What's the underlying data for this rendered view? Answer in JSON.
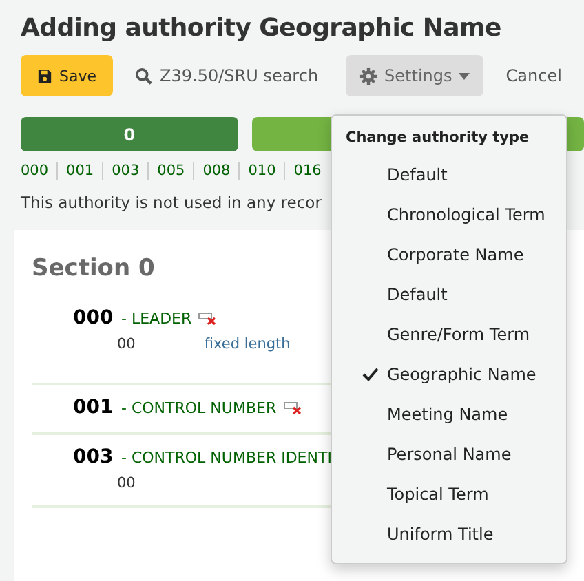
{
  "page_title": "Adding authority Geographic Name",
  "toolbar": {
    "save": "Save",
    "search": "Z39.50/SRU search",
    "settings": "Settings",
    "cancel": "Cancel"
  },
  "progress_tabs": [
    {
      "label": "0",
      "selected": true
    }
  ],
  "tag_links": [
    "000",
    "001",
    "003",
    "005",
    "008",
    "010",
    "016"
  ],
  "message": "This authority is not used in any recor",
  "section_title": "Section 0",
  "fields": [
    {
      "tag": "000",
      "name": "- LEADER",
      "deletable": true,
      "subfield": "00",
      "subfield_label": "fixed length"
    },
    {
      "tag": "001",
      "name": "- CONTROL NUMBER",
      "deletable": true
    },
    {
      "tag": "003",
      "name": "- CONTROL NUMBER IDENTI",
      "deletable": false,
      "subfield": "00"
    }
  ],
  "menu": {
    "header": "Change authority type",
    "items": [
      {
        "label": "Default",
        "selected": false
      },
      {
        "label": "Chronological Term",
        "selected": false
      },
      {
        "label": "Corporate Name",
        "selected": false
      },
      {
        "label": "Default",
        "selected": false
      },
      {
        "label": "Genre/Form Term",
        "selected": false
      },
      {
        "label": "Geographic Name",
        "selected": true
      },
      {
        "label": "Meeting Name",
        "selected": false
      },
      {
        "label": "Personal Name",
        "selected": false
      },
      {
        "label": "Topical Term",
        "selected": false
      },
      {
        "label": "Uniform Title",
        "selected": false
      }
    ]
  }
}
